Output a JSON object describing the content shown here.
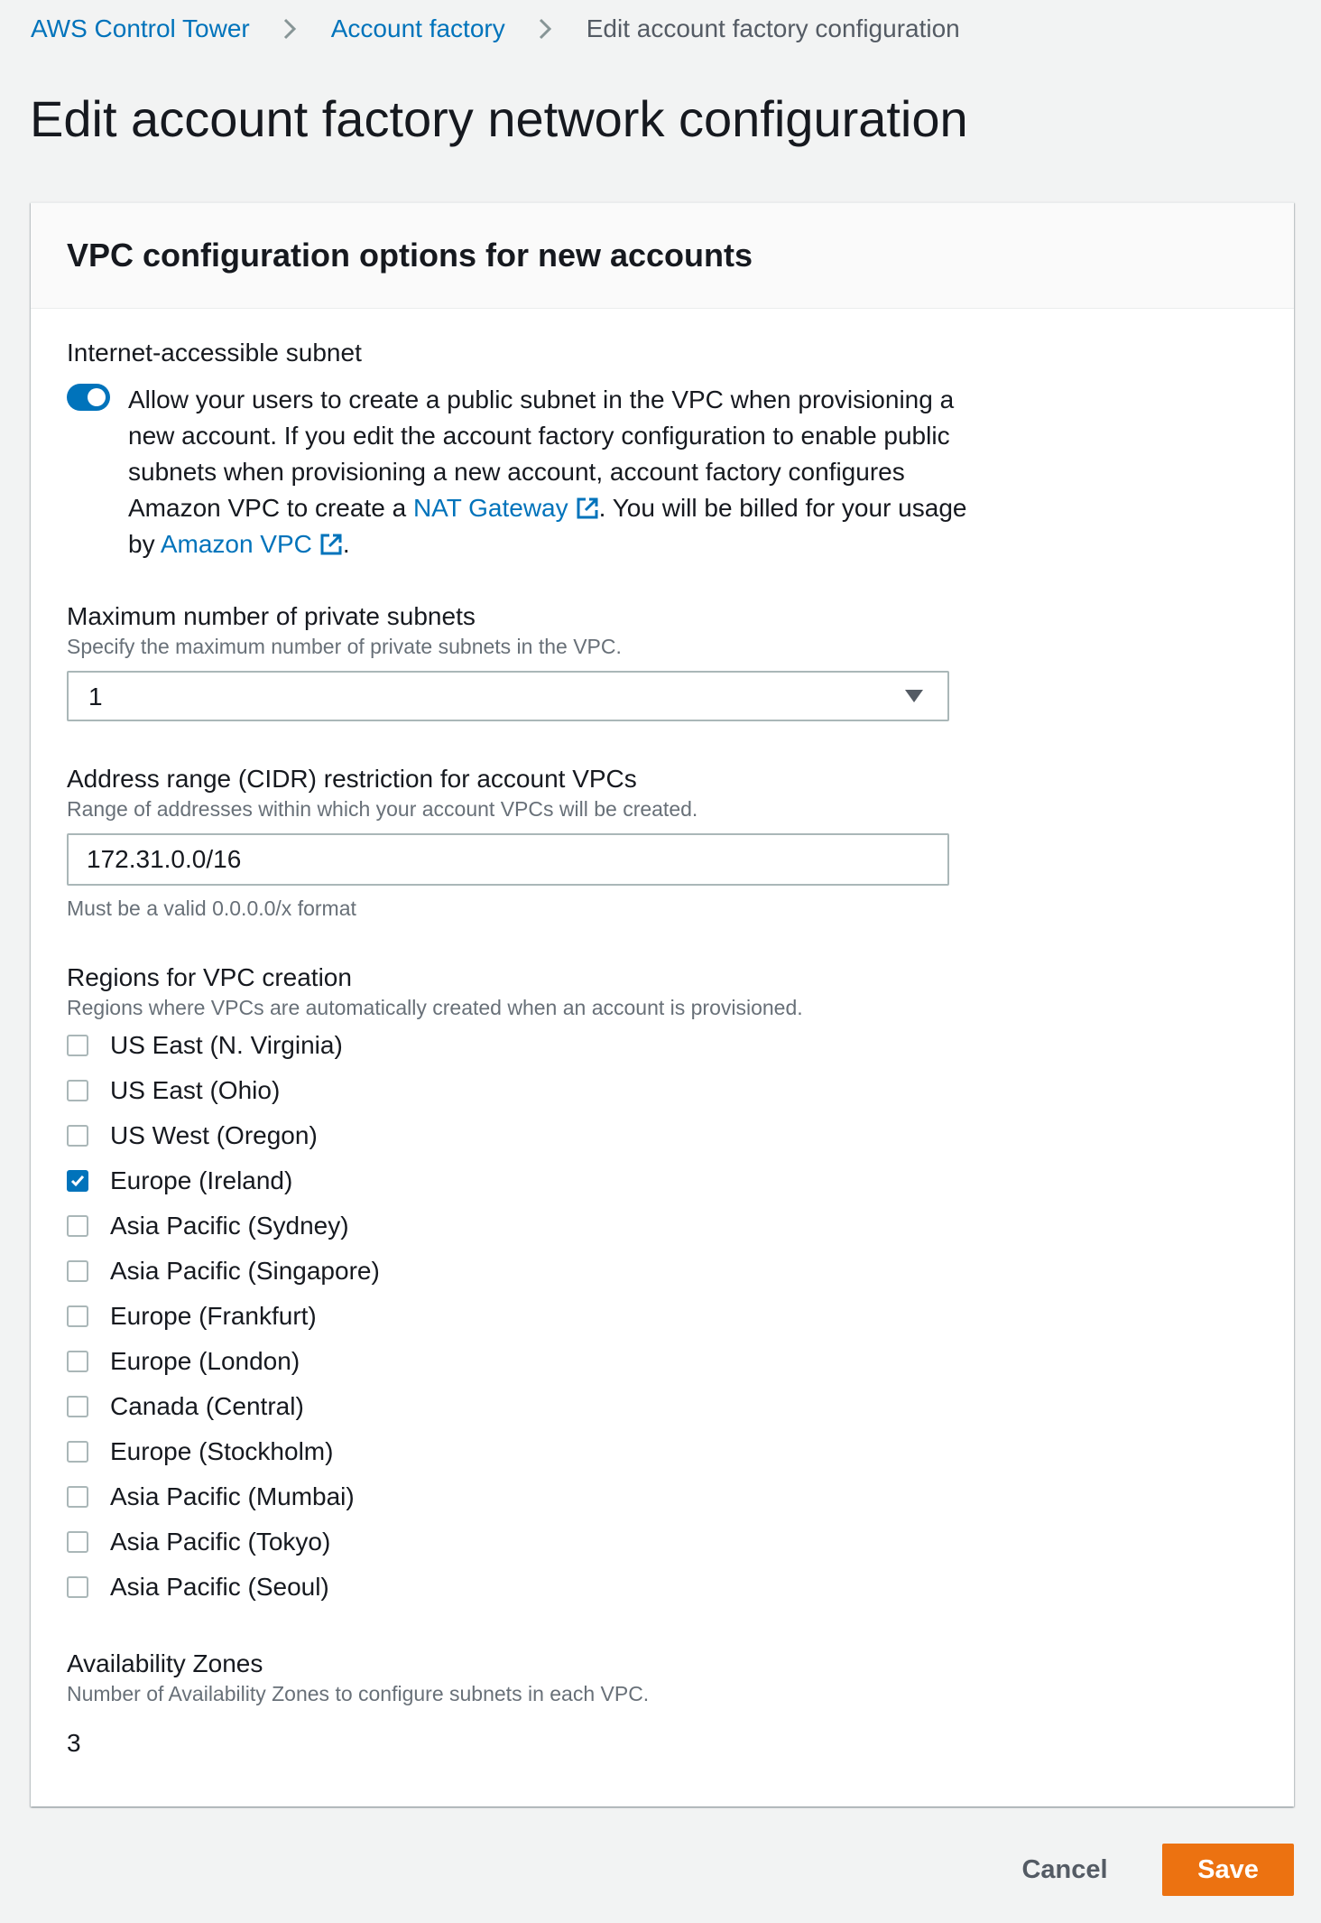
{
  "breadcrumb": {
    "items": [
      {
        "label": "AWS Control Tower",
        "type": "link"
      },
      {
        "label": "Account factory",
        "type": "link"
      },
      {
        "label": "Edit account factory configuration",
        "type": "current"
      }
    ]
  },
  "page": {
    "title": "Edit account factory network configuration"
  },
  "vpc_config": {
    "title": "VPC configuration options for new accounts",
    "internet_subnet": {
      "label": "Internet-accessible subnet",
      "enabled": true,
      "text_part1": "Allow your users to create a public subnet in the VPC when provisioning a new account. If you edit the account factory configuration to enable public subnets when provisioning a new account, account factory configures Amazon VPC to create a ",
      "link1": "NAT Gateway",
      "text_part2": ". You will be billed for your usage by ",
      "link2": "Amazon VPC",
      "text_part3": "."
    },
    "private_subnets": {
      "label": "Maximum number of private subnets",
      "description": "Specify the maximum number of private subnets in the VPC.",
      "selected": "1"
    },
    "cidr": {
      "label": "Address range (CIDR) restriction for account VPCs",
      "description": "Range of addresses within which your account VPCs will be created.",
      "value": "172.31.0.0/16",
      "constraint": "Must be a valid 0.0.0.0/x format"
    },
    "regions": {
      "label": "Regions for VPC creation",
      "description": "Regions where VPCs are automatically created when an account is provisioned.",
      "items": [
        {
          "label": "US East (N. Virginia)",
          "checked": false
        },
        {
          "label": "US East (Ohio)",
          "checked": false
        },
        {
          "label": "US West (Oregon)",
          "checked": false
        },
        {
          "label": "Europe (Ireland)",
          "checked": true
        },
        {
          "label": "Asia Pacific (Sydney)",
          "checked": false
        },
        {
          "label": "Asia Pacific (Singapore)",
          "checked": false
        },
        {
          "label": "Europe (Frankfurt)",
          "checked": false
        },
        {
          "label": "Europe (London)",
          "checked": false
        },
        {
          "label": "Canada (Central)",
          "checked": false
        },
        {
          "label": "Europe (Stockholm)",
          "checked": false
        },
        {
          "label": "Asia Pacific (Mumbai)",
          "checked": false
        },
        {
          "label": "Asia Pacific (Tokyo)",
          "checked": false
        },
        {
          "label": "Asia Pacific (Seoul)",
          "checked": false
        }
      ]
    },
    "availability_zones": {
      "label": "Availability Zones",
      "description": "Number of Availability Zones to configure subnets in each VPC.",
      "value": "3"
    }
  },
  "footer": {
    "cancel_label": "Cancel",
    "save_label": "Save"
  },
  "colors": {
    "link": "#0073bb",
    "primary_button": "#ec7211",
    "toggle_on": "#0073bb",
    "checkbox_checked": "#0073bb",
    "page_background": "#f2f3f3"
  }
}
